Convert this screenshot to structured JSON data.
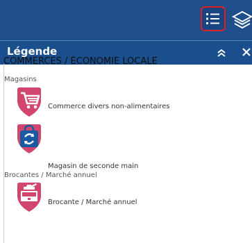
{
  "panel": {
    "title": "Légende",
    "section": "COMMERCES / ÉCONOMIE LOCALE"
  },
  "groups": [
    {
      "label": "Magasins"
    },
    {
      "label": "Brocantes / Marché annuel"
    }
  ],
  "items": [
    {
      "label": "Commerce divers non-alimentaires",
      "icon": "cart-icon"
    },
    {
      "label": "Magasin de seconde main",
      "icon": "recycle-bag-icon"
    },
    {
      "label": "Brocante / Marché annuel",
      "icon": "flea-market-icon"
    }
  ],
  "colors": {
    "topbar": "#1f4e8c",
    "header": "#1a4e8d",
    "marker": "#d2456c",
    "active_border": "#e02020"
  }
}
